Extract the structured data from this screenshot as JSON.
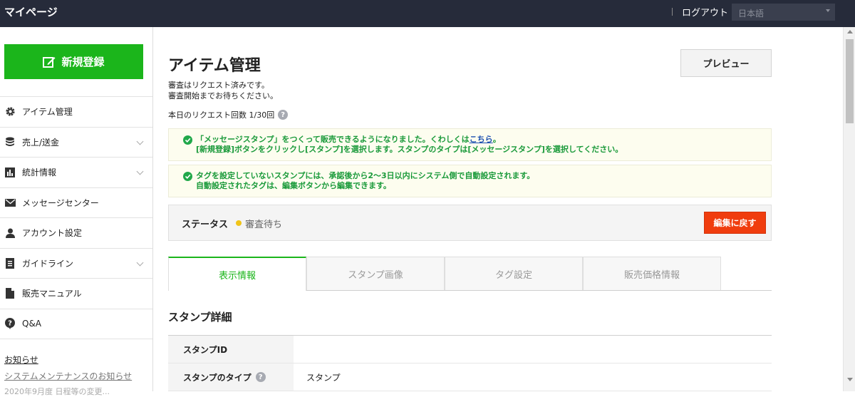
{
  "header": {
    "title": "マイページ",
    "logout": "ログアウト",
    "language": "日本語"
  },
  "sidebar": {
    "new_button": "新規登録",
    "items": [
      {
        "label": "アイテム管理",
        "icon": "gear-icon",
        "expandable": false
      },
      {
        "label": "売上/送金",
        "icon": "coins-icon",
        "expandable": true
      },
      {
        "label": "統計情報",
        "icon": "bar-chart-icon",
        "expandable": true
      },
      {
        "label": "メッセージセンター",
        "icon": "envelope-icon",
        "expandable": false
      },
      {
        "label": "アカウント設定",
        "icon": "user-icon",
        "expandable": false
      },
      {
        "label": "ガイドライン",
        "icon": "document-icon",
        "expandable": true
      },
      {
        "label": "販売マニュアル",
        "icon": "file-icon",
        "expandable": false
      },
      {
        "label": "Q&A",
        "icon": "question-bubble-icon",
        "expandable": false
      }
    ],
    "news_heading": "お知らせ",
    "news_link": "システムメンテナンスのお知らせ",
    "news_more": "2020年9月度 日程等の変更..."
  },
  "main": {
    "title": "アイテム管理",
    "preview_button": "プレビュー",
    "status_message_1": "審査はリクエスト済みです。",
    "status_message_2": "審査開始までお待ちください。",
    "request_count": "本日のリクエスト回数 1/30回",
    "notice1": {
      "line1_prefix": "「メッセージスタンプ」をつくって販売できるようになりました。くわしくは",
      "line1_link": "こちら",
      "line1_suffix": "。",
      "line2": "[新規登録]ボタンをクリックし[スタンプ]を選択します。スタンプのタイプは[メッセージスタンプ]を選択してください。"
    },
    "notice2": {
      "line1": "タグを設定していないスタンプには、承認後から2〜3日以内にシステム側で自動設定されます。",
      "line2": "自動設定されたタグは、編集ボタンから編集できます。"
    },
    "status": {
      "label": "ステータス",
      "value": "審査待ち",
      "back_button": "編集に戻す"
    },
    "tabs": [
      "表示情報",
      "スタンプ画像",
      "タグ設定",
      "販売価格情報"
    ],
    "section_title": "スタンプ詳細",
    "details": [
      {
        "key": "スタンプID",
        "value": "",
        "help": false
      },
      {
        "key": "スタンプのタイプ",
        "value": "スタンプ",
        "help": true
      }
    ]
  },
  "colors": {
    "header_bg": "#262b3a",
    "primary_green": "#1bb51b",
    "danger_red": "#f03d0e",
    "status_yellow": "#f0c419",
    "notice_text": "#1a9a3a"
  }
}
